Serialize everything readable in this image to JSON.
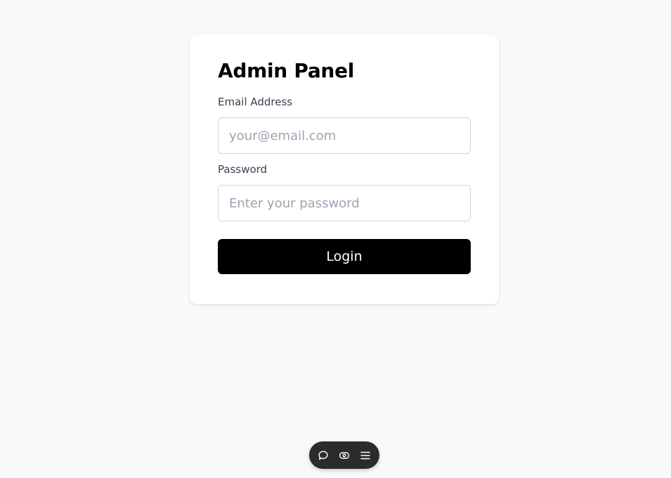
{
  "login_card": {
    "title": "Admin Panel",
    "email": {
      "label": "Email Address",
      "placeholder": "your@email.com",
      "value": ""
    },
    "password": {
      "label": "Password",
      "placeholder": "Enter your password",
      "value": ""
    },
    "submit_label": "Login"
  },
  "toolbar": {
    "icons": [
      "comment-icon",
      "eye-icon",
      "menu-icon"
    ]
  },
  "colors": {
    "page_background": "#f8f9fb",
    "card_background": "#ffffff",
    "button_background": "#000000",
    "button_text": "#ffffff",
    "toolbar_background": "#2b2b2b"
  }
}
